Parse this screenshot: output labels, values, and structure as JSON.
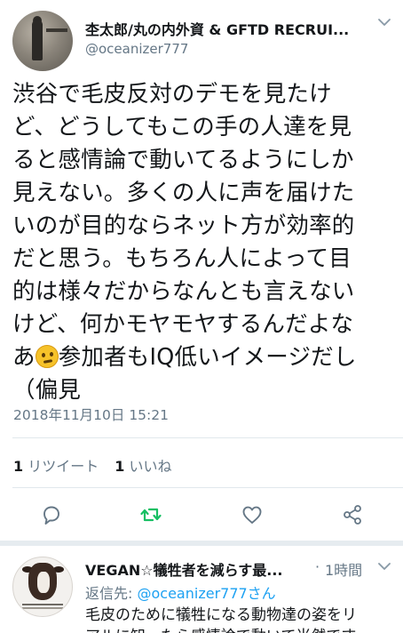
{
  "tweet": {
    "author": {
      "display_name": "杢太郎/丸の内外資 & GFTD RECRUI...",
      "handle": "@oceanizer777"
    },
    "text_before_emoji": "渋谷で毛皮反対のデモを見たけ\nど、どうしてもこの手の人達を見\nると感情論で動いてるようにしか\n見えない。多くの人に声を届けた\nいのが目的ならネット方が効率的\nだと思う。もちろん人によって目\n的は様々だからなんとも言えない\nけど、何かモヤモヤするんだよな\nあ",
    "emoji": "thinking-face-icon",
    "text_after_emoji": "参加者もIQ低いイメージだし\n（偏見",
    "timestamp": "2018年11月10日 15:21",
    "stats": {
      "retweet_count": "1",
      "retweet_label": "リツイート",
      "like_count": "1",
      "like_label": "いいね"
    },
    "actions": [
      "reply-icon",
      "retweet-icon",
      "like-icon",
      "share-icon"
    ],
    "colors": {
      "retweet_active": "#17bf63",
      "icon_gray": "#657786",
      "link_blue": "#1da1f2"
    }
  },
  "reply": {
    "author": {
      "display_name": "VEGAN☆犠牲者を減らす最...",
      "separator": "·",
      "time": "1時間"
    },
    "reply_to_prefix": "返信先:",
    "reply_to_mention": "@oceanizer777さん",
    "text": "毛皮のために犠牲になる動物達の姿をリ\nアルに知ったら感情論で動いて当然です"
  }
}
